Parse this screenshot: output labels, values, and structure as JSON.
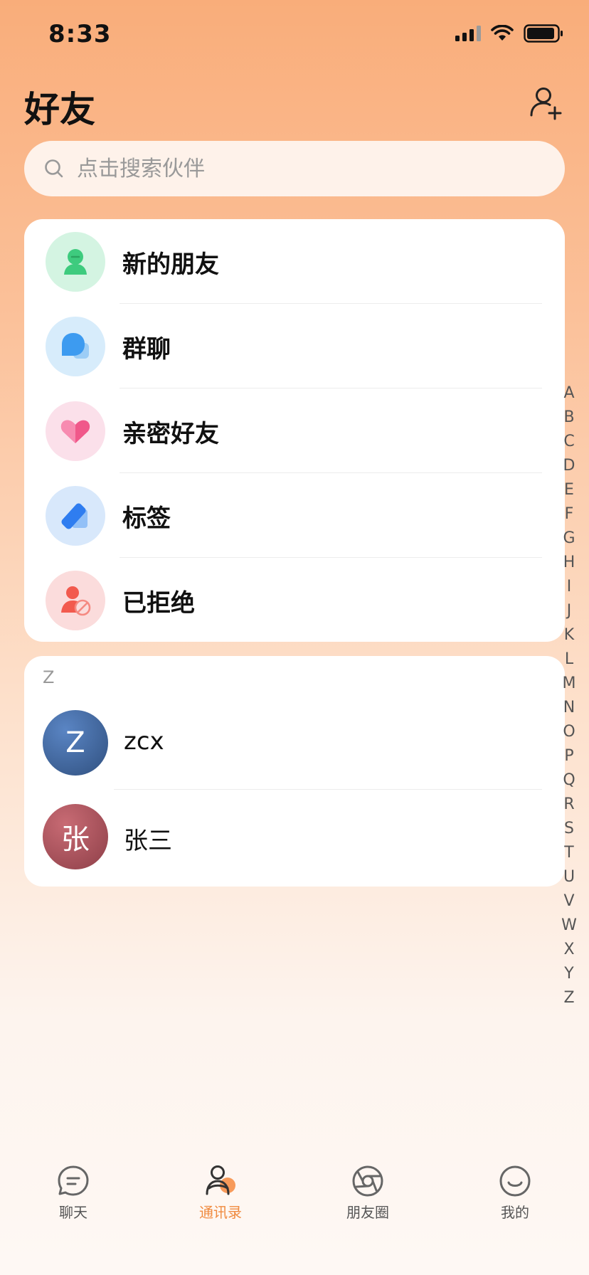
{
  "status_bar": {
    "time": "8:33"
  },
  "header": {
    "title": "好友",
    "add_icon": "add-user-icon"
  },
  "search": {
    "placeholder": "点击搜索伙伴"
  },
  "menu": [
    {
      "label": "新的朋友",
      "icon": "new-friend-icon",
      "color": "#3ecb7e"
    },
    {
      "label": "群聊",
      "icon": "group-chat-icon",
      "color": "#3d9bf0"
    },
    {
      "label": "亲密好友",
      "icon": "heart-icon",
      "color": "#f0588a"
    },
    {
      "label": "标签",
      "icon": "tag-icon",
      "color": "#2f7df0"
    },
    {
      "label": "已拒绝",
      "icon": "rejected-icon",
      "color": "#f25a4e"
    }
  ],
  "contacts": {
    "section": "Z",
    "items": [
      {
        "avatar_text": "Z",
        "name": "zcx",
        "avatar_color": "#3a5e96"
      },
      {
        "avatar_text": "张",
        "name": "张三",
        "avatar_color": "#a9515b"
      }
    ]
  },
  "alphabet": [
    "A",
    "B",
    "C",
    "D",
    "E",
    "F",
    "G",
    "H",
    "I",
    "J",
    "K",
    "L",
    "M",
    "N",
    "O",
    "P",
    "Q",
    "R",
    "S",
    "T",
    "U",
    "V",
    "W",
    "X",
    "Y",
    "Z"
  ],
  "tabs": [
    {
      "label": "聊天",
      "icon": "chat-icon",
      "active": false
    },
    {
      "label": "通讯录",
      "icon": "contacts-icon",
      "active": true
    },
    {
      "label": "朋友圈",
      "icon": "moments-icon",
      "active": false
    },
    {
      "label": "我的",
      "icon": "profile-icon",
      "active": false
    }
  ],
  "colors": {
    "accent": "#f08a3e",
    "background_top": "#f9ad7a",
    "background_bottom": "#fef8f4"
  }
}
